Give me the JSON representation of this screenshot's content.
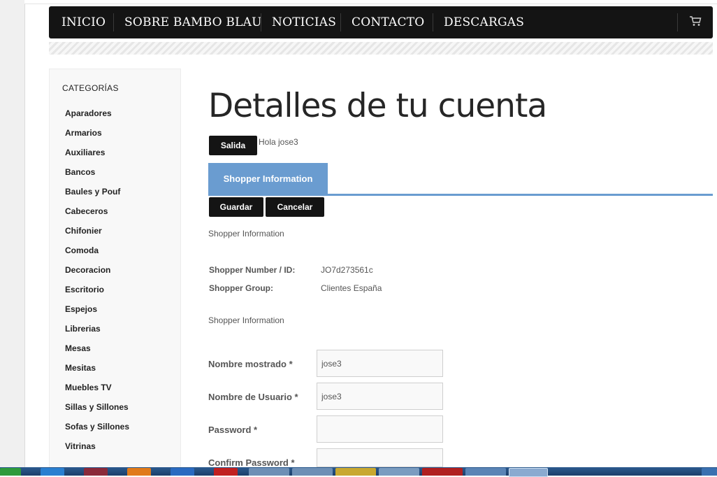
{
  "nav": {
    "items": [
      "INICIO",
      "SOBRE BAMBO BLAU",
      "NOTICIAS",
      "CONTACTO",
      "DESCARGAS"
    ],
    "cart_icon": "cart-icon"
  },
  "sidebar": {
    "title": "CATEGORÍAS",
    "categories": [
      "Aparadores",
      "Armarios",
      "Auxiliares",
      "Bancos",
      "Baules y Pouf",
      "Cabeceros",
      "Chifonier",
      "Comoda",
      "Decoracion",
      "Escritorio",
      "Espejos",
      "Librerias",
      "Mesas",
      "Mesitas",
      "Muebles TV",
      "Sillas y Sillones",
      "Sofas y Sillones",
      "Vitrinas"
    ]
  },
  "main": {
    "title": "Detalles de tu cuenta",
    "logout_label": "Salida",
    "greeting": "Hola jose3",
    "tab_label": "Shopper Information",
    "save_label": "Guardar",
    "cancel_label": "Cancelar",
    "section1_title": "Shopper Information",
    "shopper_number_label": "Shopper Number / ID:",
    "shopper_number_value": "JO7d273561c",
    "shopper_group_label": "Shopper Group:",
    "shopper_group_value": "Clientes España",
    "section2_title": "Shopper Information",
    "fields": [
      {
        "label": "Nombre mostrado *",
        "value": "jose3"
      },
      {
        "label": "Nombre de Usuario *",
        "value": "jose3"
      },
      {
        "label": "Password *",
        "value": ""
      },
      {
        "label": "Confirm Password *",
        "value": ""
      }
    ]
  },
  "colors": {
    "nav_bg": "#141414",
    "tab_accent": "#6a9cd0"
  }
}
